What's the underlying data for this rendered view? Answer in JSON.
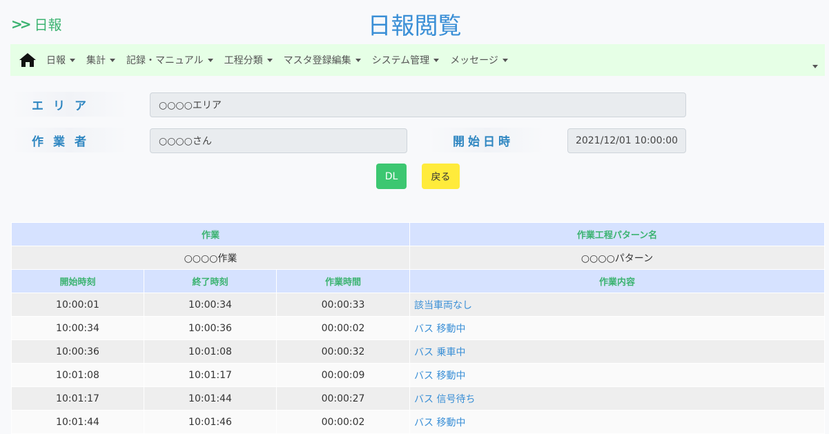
{
  "header": {
    "brand": "日報",
    "title": "日報閲覧"
  },
  "nav": {
    "items": [
      "日報",
      "集計",
      "記録・マニュアル",
      "工程分類",
      "マスタ登録編集",
      "システム管理",
      "メッセージ"
    ]
  },
  "form": {
    "area_label": "エリア",
    "area_value": "○○○○エリア",
    "worker_label": "作業者",
    "worker_value": "○○○○さん",
    "start_label": "開始日時",
    "start_value": "2021/12/01 10:00:00"
  },
  "buttons": {
    "dl": "DL",
    "back": "戻る"
  },
  "table": {
    "header1": {
      "work": "作業",
      "pattern": "作業工程パターン名"
    },
    "info": {
      "work": "○○○○作業",
      "pattern": "○○○○パターン"
    },
    "header2": {
      "start": "開始時刻",
      "end": "終了時刻",
      "duration": "作業時間",
      "content": "作業内容"
    },
    "rows": [
      {
        "start": "10:00:01",
        "end": "10:00:34",
        "duration": "00:00:33",
        "content": "該当車両なし"
      },
      {
        "start": "10:00:34",
        "end": "10:00:36",
        "duration": "00:00:02",
        "content": "バス 移動中"
      },
      {
        "start": "10:00:36",
        "end": "10:01:08",
        "duration": "00:00:32",
        "content": "バス 乗車中"
      },
      {
        "start": "10:01:08",
        "end": "10:01:17",
        "duration": "00:00:09",
        "content": "バス 移動中"
      },
      {
        "start": "10:01:17",
        "end": "10:01:44",
        "duration": "00:00:27",
        "content": "バス 信号待ち"
      },
      {
        "start": "10:01:44",
        "end": "10:01:46",
        "duration": "00:00:02",
        "content": "バス 移動中"
      }
    ]
  }
}
